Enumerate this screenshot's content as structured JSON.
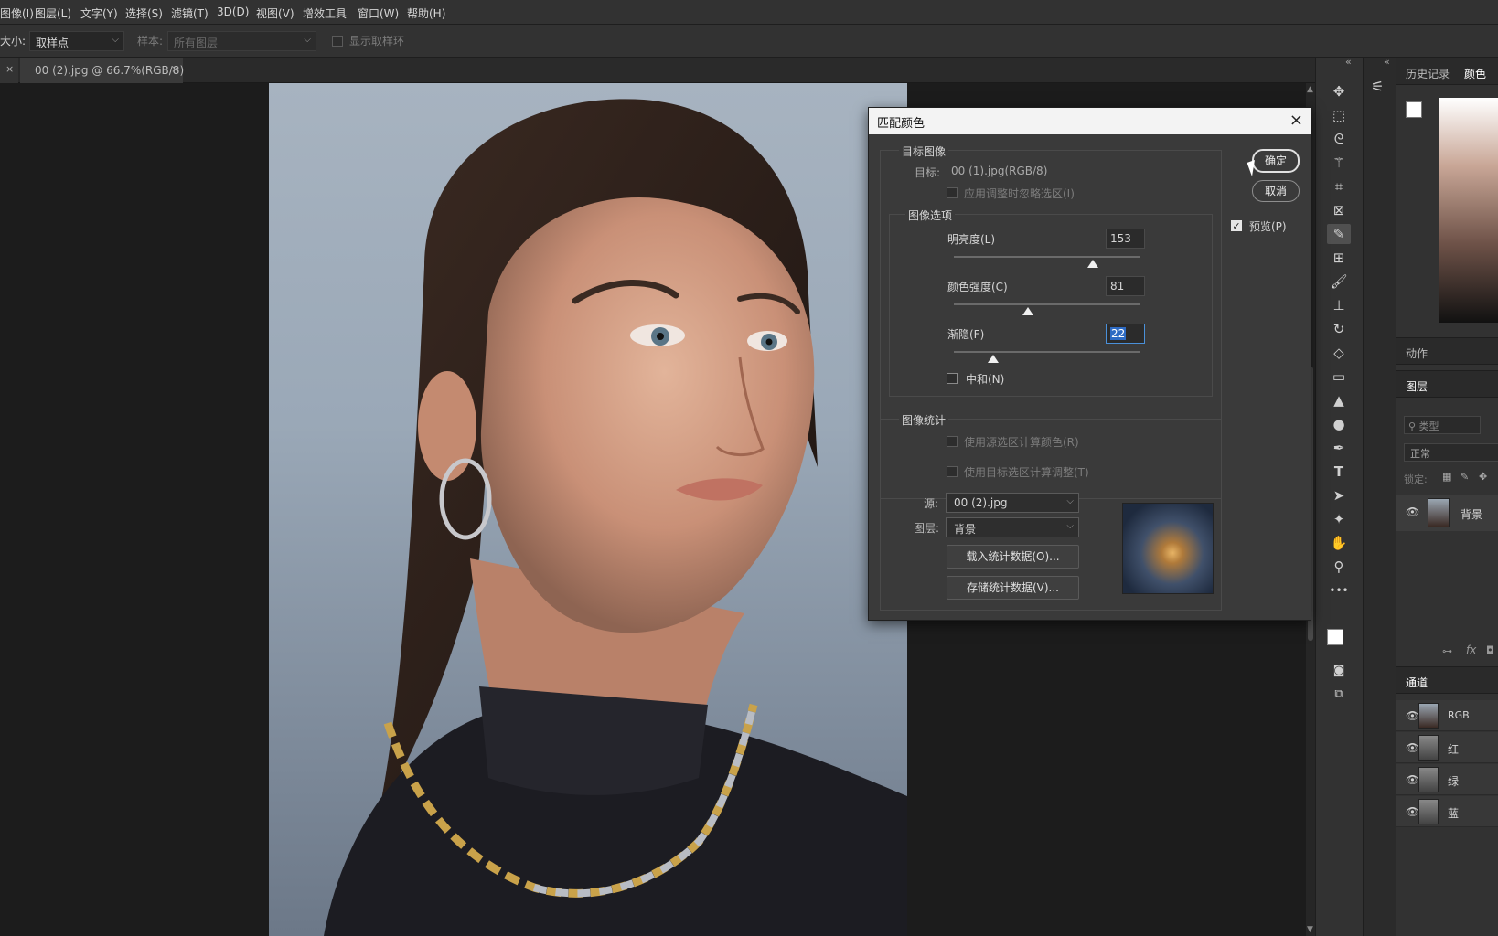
{
  "menu": [
    "图像(I)",
    "图层(L)",
    "文字(Y)",
    "选择(S)",
    "滤镜(T)",
    "3D(D)",
    "视图(V)",
    "增效工具",
    "窗口(W)",
    "帮助(H)"
  ],
  "options": {
    "size_label": "大小:",
    "size_value": "取样点",
    "sample_label": "样本:",
    "sample_value": "所有图层",
    "show_ring": "显示取样环"
  },
  "document_tab": {
    "title": "00 (2).jpg @ 66.7%(RGB/8)",
    "close": "×"
  },
  "dialog": {
    "title": "匹配颜色",
    "close": "×",
    "target_group": "目标图像",
    "target_label": "目标:",
    "target_value": "00 (1).jpg(RGB/8)",
    "ignore_selection": "应用调整时忽略选区(I)",
    "image_options_group": "图像选项",
    "luminance_label": "明亮度(L)",
    "luminance_value": "153",
    "luminance_pct": 0.75,
    "intensity_label": "颜色强度(C)",
    "intensity_value": "81",
    "intensity_pct": 0.4,
    "fade_label": "渐隐(F)",
    "fade_value": "22",
    "fade_pct": 0.21,
    "neutralize": "中和(N)",
    "stats_group": "图像统计",
    "use_source_selection": "使用源选区计算颜色(R)",
    "use_target_selection": "使用目标选区计算调整(T)",
    "source_label": "源:",
    "source_value": "00 (2).jpg",
    "layer_label": "图层:",
    "layer_value": "背景",
    "load_stats": "载入统计数据(O)...",
    "save_stats": "存储统计数据(V)...",
    "ok": "确定",
    "cancel": "取消",
    "preview": "预览(P)",
    "preview_check": "✓"
  },
  "panels": {
    "history_tab": "历史记录",
    "color_tab": "颜色",
    "actions_tab": "动作",
    "layers_tab": "图层",
    "search_placeholder": "类型",
    "blend_mode": "正常",
    "lock_label": "锁定:",
    "bg_layer": "背景",
    "fx": "fx",
    "channels_tab": "通道",
    "channels": [
      "RGB",
      "红",
      "绿",
      "蓝"
    ]
  },
  "icons": {
    "eye": "👁",
    "collapse": "«",
    "menu_more": "•••"
  }
}
